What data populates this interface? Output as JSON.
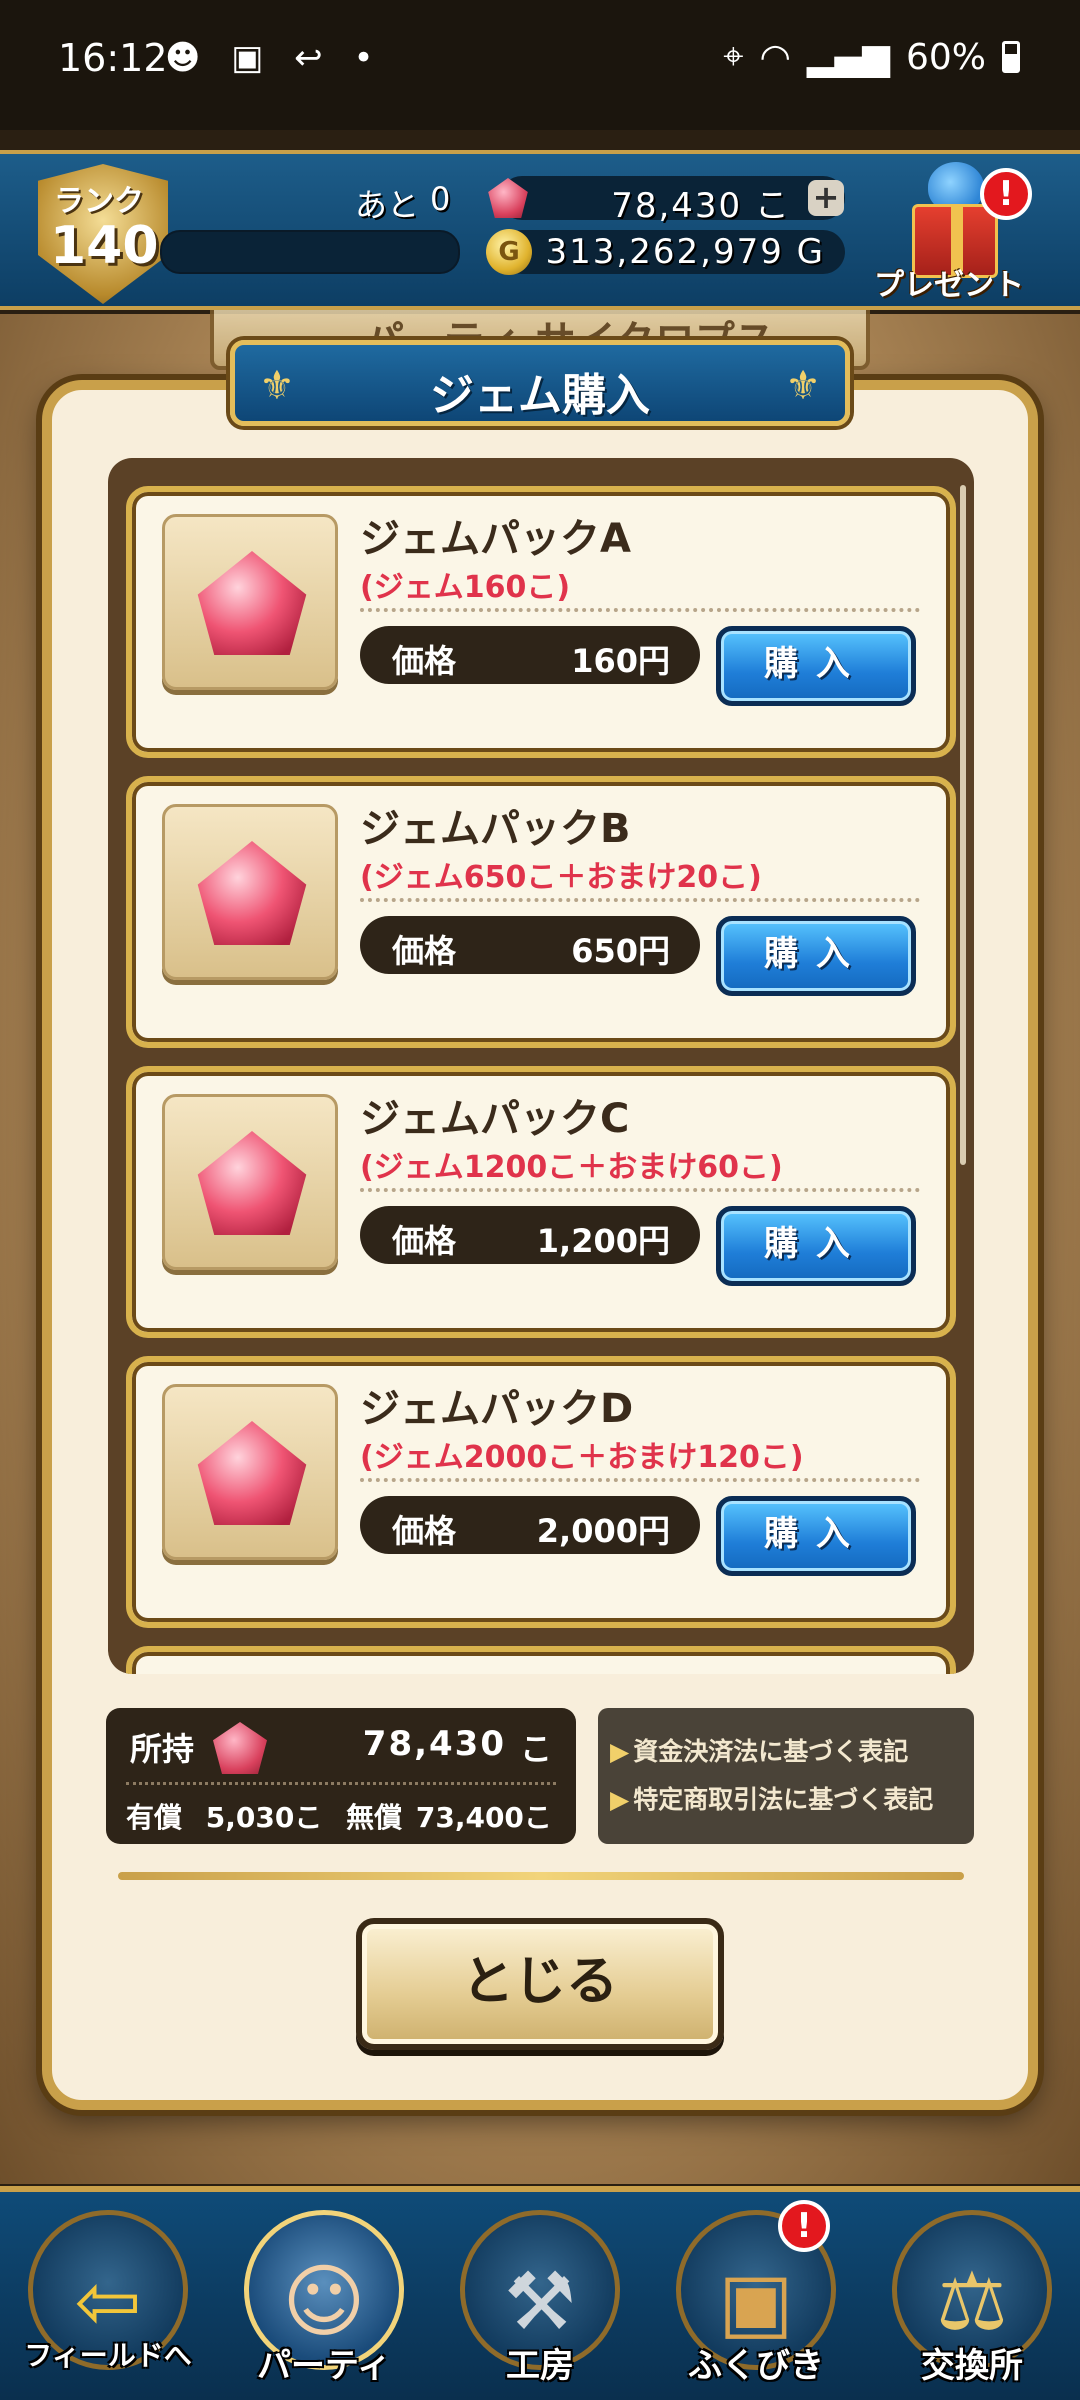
{
  "status_bar": {
    "time": "16:12",
    "notification_icons": "☻ ▣ ↩ •",
    "battery": "60%",
    "icons": [
      "location-icon",
      "wifi-icon",
      "signal-icon",
      "battery-icon"
    ]
  },
  "hud": {
    "rank_label": "ランク",
    "rank_value": "140",
    "ato_label": "あと",
    "ato_value": "0",
    "gems": "78,430 こ",
    "gold": "313,262,979 G",
    "gold_icon": "G",
    "plus": "+",
    "present_label": "プレゼント",
    "present_alert": "!"
  },
  "background": {
    "party_tab": "パーティ サイクロプス"
  },
  "modal": {
    "title": "ジェム購入",
    "packs": [
      {
        "name": "ジェムパックA",
        "desc": "(ジェム160こ)",
        "price_label": "価格",
        "price": "160円",
        "buy": "購入"
      },
      {
        "name": "ジェムパックB",
        "desc": "(ジェム650こ＋おまけ20こ)",
        "price_label": "価格",
        "price": "650円",
        "buy": "購入"
      },
      {
        "name": "ジェムパックC",
        "desc": "(ジェム1200こ＋おまけ60こ)",
        "price_label": "価格",
        "price": "1,200円",
        "buy": "購入"
      },
      {
        "name": "ジェムパックD",
        "desc": "(ジェム2000こ＋おまけ120こ)",
        "price_label": "価格",
        "price": "2,000円",
        "buy": "購入"
      }
    ],
    "owned": {
      "label": "所持",
      "value": "78,430",
      "unit": "こ",
      "paid_label": "有償",
      "paid_value": "5,030こ",
      "free_label": "無償",
      "free_value": "73,400こ"
    },
    "legal": {
      "link1": "資金決済法に基づく表記",
      "link2": "特定商取引法に基づく表記"
    },
    "close": "とじる"
  },
  "bottom_nav": [
    {
      "label": "フィールドへ",
      "icon": "field-arrow-icon"
    },
    {
      "label": "パーティ",
      "icon": "hero-portrait-icon"
    },
    {
      "label": "工房",
      "icon": "forge-hammer-icon"
    },
    {
      "label": "ふくびき",
      "icon": "treasure-chest-icon",
      "alert": "!"
    },
    {
      "label": "交換所",
      "icon": "scale-icon"
    }
  ],
  "colors": {
    "accent_gold": "#c9a04a",
    "buy_blue": "#1f7ed8",
    "desc_red": "#e0334b",
    "hud_blue": "#1d5d8a"
  }
}
